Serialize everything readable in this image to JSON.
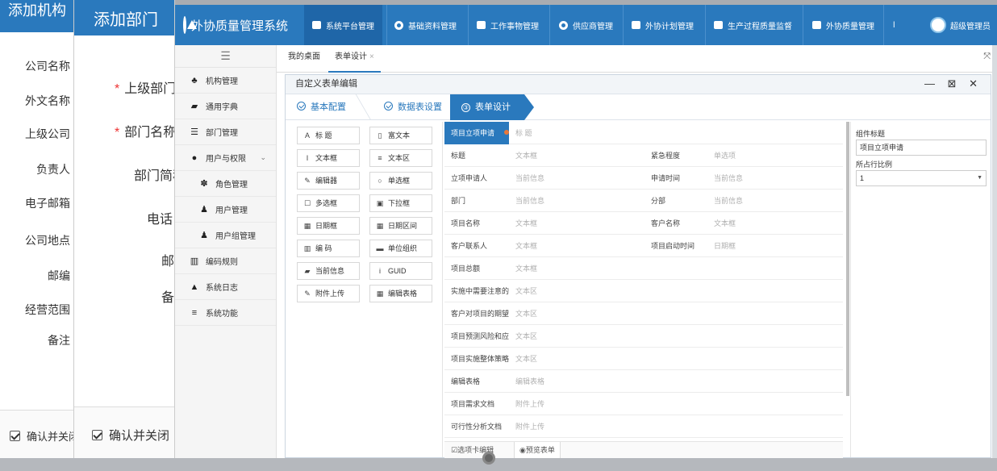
{
  "dialog_org": {
    "title": "添加机构",
    "labels": [
      "公司名称",
      "外文名称",
      "上级公司",
      "负责人",
      "电子邮箱",
      "公司地点",
      "邮编",
      "经营范围",
      "备注"
    ],
    "confirm_close": "确认并关闭"
  },
  "dialog_dept": {
    "title": "添加部门",
    "labels": [
      "上级部门",
      "部门名称",
      "部门简称",
      "电话",
      "邮编",
      "备注"
    ],
    "confirm_close": "确认并关闭"
  },
  "app": {
    "title": "外协质量管理系统",
    "nav": [
      "系统平台管理",
      "基础资料管理",
      "工作事物管理",
      "供应商管理",
      "外协计划管理",
      "生产过程质量监督",
      "外协质量管理"
    ],
    "nav_more": "ǀ",
    "user": "超级管理员"
  },
  "sidebar": {
    "toggle": "☰",
    "items": [
      {
        "icon": "sitemap-icon",
        "glyph": "♣",
        "label": "机构管理"
      },
      {
        "icon": "book-icon",
        "glyph": "▰",
        "label": "通用字典"
      },
      {
        "icon": "list-icon",
        "glyph": "☰",
        "label": "部门管理"
      },
      {
        "icon": "circle-icon",
        "glyph": "●",
        "label": "用户与权限",
        "expanded": true
      },
      {
        "icon": "paw-icon",
        "glyph": "✽",
        "label": "角色管理",
        "sub": true
      },
      {
        "icon": "user-icon",
        "glyph": "♟",
        "label": "用户管理",
        "sub": true
      },
      {
        "icon": "users-icon",
        "glyph": "♟",
        "label": "用户组管理",
        "sub": true
      },
      {
        "icon": "barcode-icon",
        "glyph": "▥",
        "label": "编码规则"
      },
      {
        "icon": "warning-icon",
        "glyph": "▲",
        "label": "系统日志"
      },
      {
        "icon": "menu-icon",
        "glyph": "≡",
        "label": "系统功能"
      }
    ]
  },
  "tabs": [
    {
      "label": "我的桌面"
    },
    {
      "label": "表单设计",
      "close": "×"
    }
  ],
  "panel": {
    "title": "自定义表单编辑",
    "controls": "— ⊠ ✕",
    "steps": [
      {
        "label": "基本配置"
      },
      {
        "label": "数据表设置"
      },
      {
        "num": "③",
        "label": "表单设计"
      }
    ]
  },
  "widgets": [
    {
      "glyph": "A",
      "label": "标 题"
    },
    {
      "glyph": "▯",
      "label": "富文本"
    },
    {
      "glyph": "I",
      "label": "文本框"
    },
    {
      "glyph": "≡",
      "label": "文本区"
    },
    {
      "glyph": "✎",
      "label": "编辑器"
    },
    {
      "glyph": "○",
      "label": "单选框"
    },
    {
      "glyph": "☐",
      "label": "多选框"
    },
    {
      "glyph": "▣",
      "label": "下拉框"
    },
    {
      "glyph": "▦",
      "label": "日期框"
    },
    {
      "glyph": "▦",
      "label": "日期区间"
    },
    {
      "glyph": "▥",
      "label": "编 码"
    },
    {
      "glyph": "▬",
      "label": "单位组织"
    },
    {
      "glyph": "▰",
      "label": "当前信息"
    },
    {
      "glyph": "i",
      "label": "GUID"
    },
    {
      "glyph": "✎",
      "label": "附件上传"
    },
    {
      "glyph": "▦",
      "label": "编辑表格"
    }
  ],
  "form_rows": [
    {
      "cells": [
        "项目立项申请",
        "标 题"
      ],
      "selected": true
    },
    {
      "cells": [
        "标题",
        "文本框",
        "紧急程度",
        "单选项"
      ]
    },
    {
      "cells": [
        "立项申请人",
        "当前信息",
        "申请时间",
        "当前信息"
      ]
    },
    {
      "cells": [
        "部门",
        "当前信息",
        "分部",
        "当前信息"
      ]
    },
    {
      "cells": [
        "项目名称",
        "文本框",
        "客户名称",
        "文本框"
      ]
    },
    {
      "cells": [
        "客户联系人",
        "文本框",
        "项目启动时间",
        "日期框"
      ]
    },
    {
      "cells": [
        "项目总额",
        "文本框"
      ]
    },
    {
      "cells": [
        "实施中需要注意的",
        "文本区"
      ]
    },
    {
      "cells": [
        "客户对项目的期望",
        "文本区"
      ]
    },
    {
      "cells": [
        "项目预测风险和应",
        "文本区"
      ]
    },
    {
      "cells": [
        "项目实施整体策略",
        "文本区"
      ]
    },
    {
      "cells": [
        "编辑表格",
        "编辑表格"
      ]
    },
    {
      "cells": [
        "项目需求文档",
        "附件上传"
      ]
    },
    {
      "cells": [
        "可行性分析文档",
        "附件上传"
      ]
    }
  ],
  "form_footer": {
    "tab_edit": "☑选项卡编辑",
    "preview": "◉预览表单"
  },
  "properties": {
    "label1": "组件标题",
    "value1": "项目立项申请",
    "label2": "所占行比例",
    "value2": "1"
  }
}
